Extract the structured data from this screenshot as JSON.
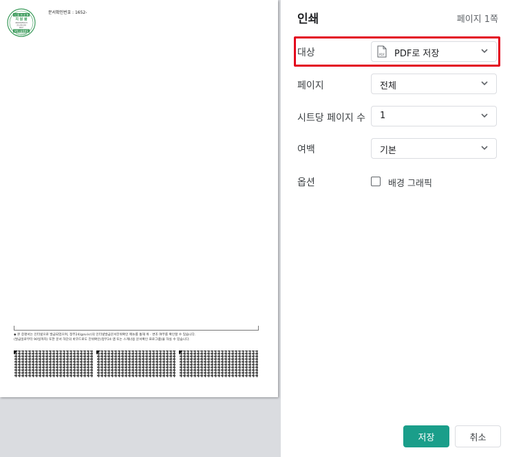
{
  "preview": {
    "doc_number_label": "문서확인번호 : 1652-",
    "seal_text": [
      "시 흥 제 공 확",
      "지 원 봄",
      "2022/05/13",
      "21:00:00",
      "837",
      "부착시설해제임",
      "시흥시설해제임"
    ],
    "notice_line_1": "◆ 본 증명서는 인터넷으로 발급되었으며, 정부24(gov.kr)의 인터넷발급문서진위확인 메뉴를 통해 위 · 변조 여부를 확인할 수 있습니다.",
    "notice_line_2": "(발급일로부터 90일까지) 또한 문서 하단의 바코드로도 진위확인(정부24 앱 또는 스캐너용 문서확인 프로그램)을 하실 수 있습니다."
  },
  "dialog": {
    "title": "인쇄",
    "page_count": "페이지 1쪽"
  },
  "settings": {
    "destination": {
      "label": "대상",
      "value": "PDF로 저장",
      "file_icon_text": "PDF"
    },
    "pages": {
      "label": "페이지",
      "value": "전체"
    },
    "pages_per_sheet": {
      "label": "시트당 페이지 수",
      "value": "1"
    },
    "margins": {
      "label": "여백",
      "value": "기본"
    },
    "options": {
      "label": "옵션",
      "background_graphics_label": "배경 그래픽",
      "background_graphics_checked": false
    }
  },
  "actions": {
    "save_label": "저장",
    "cancel_label": "취소"
  },
  "colors": {
    "accent": "#1a9e8a",
    "highlight": "#e3001b",
    "seal": "#3a9a5a"
  }
}
